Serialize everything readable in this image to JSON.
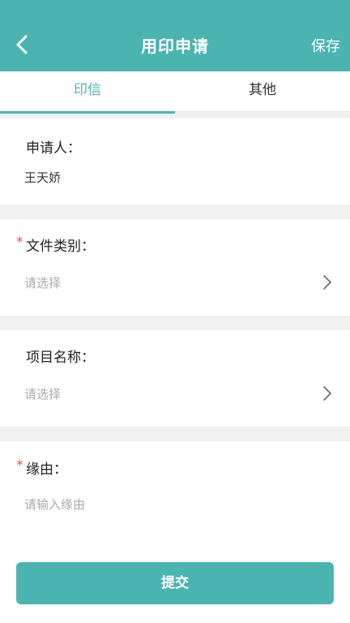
{
  "header": {
    "title": "用印申请",
    "save_label": "保存",
    "back_icon": "chevron-left-icon"
  },
  "tabs": [
    {
      "label": "印信",
      "active": true
    },
    {
      "label": "其他",
      "active": false
    }
  ],
  "form": {
    "applicant": {
      "label": "申请人：",
      "value": "王天娇"
    },
    "file_category": {
      "required_mark": "*",
      "label": "文件类别：",
      "placeholder": "请选择"
    },
    "project_name": {
      "label": "项目名称：",
      "placeholder": "请选择"
    },
    "reason": {
      "required_mark": "*",
      "label": "缘由：",
      "placeholder": "请输入缘由"
    }
  },
  "submit_label": "提交",
  "colors": {
    "accent": "#4bb4b0",
    "required": "#d9534f",
    "background": "#f1f1f1"
  }
}
